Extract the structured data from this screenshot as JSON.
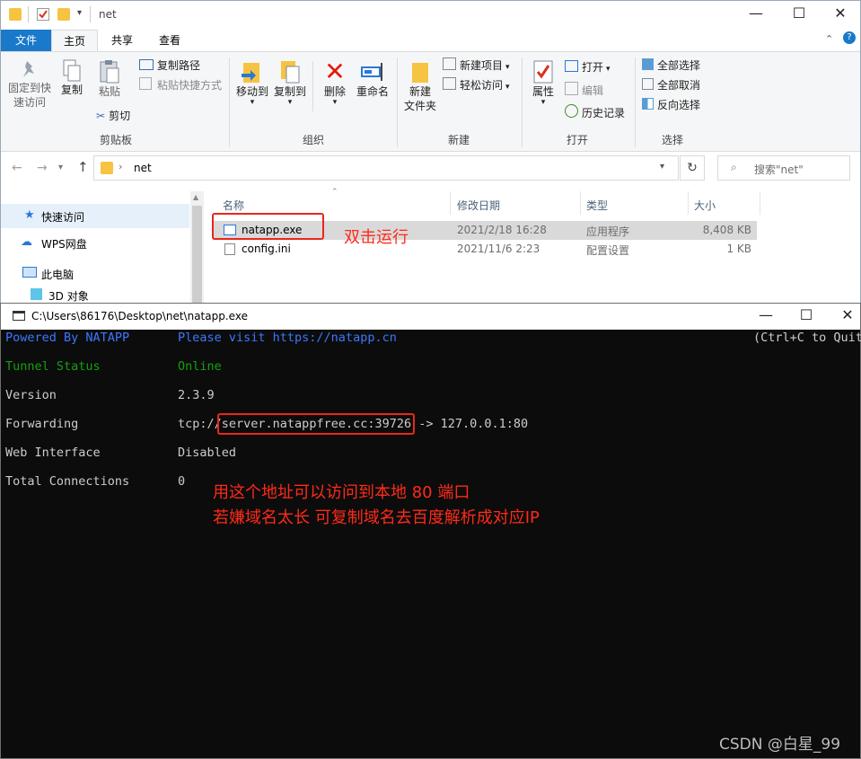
{
  "explorer": {
    "title": "net",
    "tabs": [
      "文件",
      "主页",
      "共享",
      "查看"
    ],
    "ribbon": {
      "clipboard": {
        "pin": "固定到快速访问",
        "pin_l1": "固定到快",
        "pin_l2": "速访问",
        "copy": "复制",
        "paste": "粘贴",
        "copy_path": "复制路径",
        "paste_shortcut": "粘贴快捷方式",
        "cut": "剪切",
        "label": "剪贴板"
      },
      "organize": {
        "move_to": "移动到",
        "copy_to": "复制到",
        "delete": "删除",
        "rename": "重命名",
        "label": "组织"
      },
      "new": {
        "new_folder_l1": "新建",
        "new_folder_l2": "文件夹",
        "new_item": "新建项目",
        "easy_access": "轻松访问",
        "label": "新建"
      },
      "open": {
        "properties": "属性",
        "open": "打开",
        "edit": "编辑",
        "history": "历史记录",
        "label": "打开"
      },
      "select": {
        "select_all": "全部选择",
        "select_none": "全部取消",
        "invert": "反向选择",
        "label": "选择"
      }
    },
    "address": "net",
    "search_placeholder": "搜索\"net\"",
    "nav": [
      "快速访问",
      "WPS网盘",
      "此电脑",
      "3D 对象"
    ],
    "columns": [
      "名称",
      "修改日期",
      "类型",
      "大小"
    ],
    "files": [
      {
        "name": "natapp.exe",
        "date": "2021/2/18 16:28",
        "type": "应用程序",
        "size": "8,408 KB"
      },
      {
        "name": "config.ini",
        "date": "2021/11/6 2:23",
        "type": "配置设置",
        "size": "1 KB"
      }
    ]
  },
  "console": {
    "title": "C:\\Users\\86176\\Desktop\\net\\natapp.exe",
    "powered_label": "Powered By NATAPP",
    "powered_value": "Please visit https://natapp.cn",
    "ctrl_hint": "(Ctrl+C to Quit",
    "rows": [
      {
        "label": "Tunnel Status",
        "value": "Online"
      },
      {
        "label": "Version",
        "value": "2.3.9"
      },
      {
        "label": "Forwarding",
        "prefix": "tcp://",
        "address": "server.natappfree.cc:39726",
        "suffix": " -> 127.0.0.1:80"
      },
      {
        "label": "Web Interface",
        "value": "Disabled"
      },
      {
        "label": "Total Connections",
        "value": "0"
      }
    ]
  },
  "annotations": {
    "double_click": "双击运行",
    "line1": "用这个地址可以访问到本地 80 端口",
    "line2": "若嫌域名太长 可复制域名去百度解析成对应IP"
  },
  "watermark": "CSDN @白星_99",
  "colors": {
    "annotation": "#ff2a1a",
    "console_bg": "#0c0c0c",
    "console_green": "#13a10e",
    "file_tab": "#1979ca"
  }
}
